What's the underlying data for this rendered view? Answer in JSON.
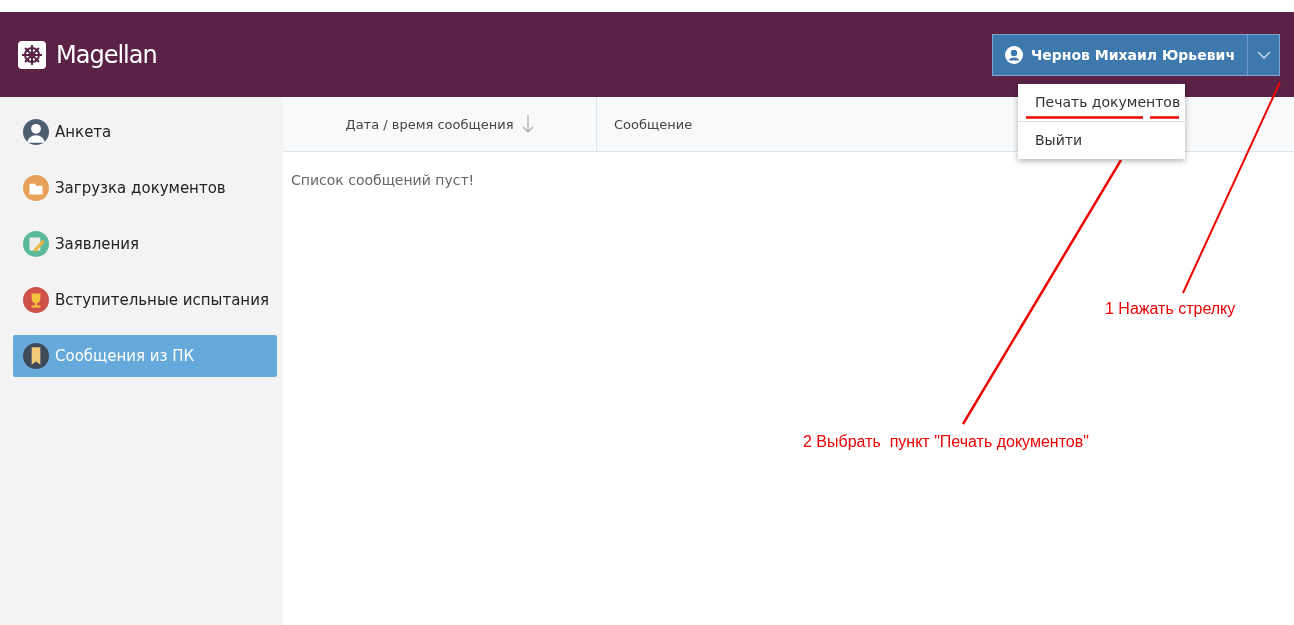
{
  "app": {
    "title": "Magellan"
  },
  "user": {
    "name": "Чернов Михаил Юрьевич",
    "menu_open": true
  },
  "user_menu": [
    {
      "label": "Печать документов"
    },
    {
      "label": "Выйти"
    }
  ],
  "sidebar": {
    "items": [
      {
        "label": "Анкета",
        "kind": "person",
        "color": "#4e5e72",
        "selected": false
      },
      {
        "label": "Загрузка документов",
        "kind": "folder",
        "color": "#e8a15a",
        "selected": false
      },
      {
        "label": "Заявления",
        "kind": "edit",
        "color": "#5cb99a",
        "selected": false
      },
      {
        "label": "Вступительные испытания",
        "kind": "trophy",
        "color": "#d0504a",
        "selected": false
      },
      {
        "label": "Сообщения из ПК",
        "kind": "bookmark",
        "color": "#3f4b5b",
        "selected": true
      }
    ]
  },
  "table": {
    "columns": [
      {
        "label": "Дата / время сообщения",
        "sorted": true
      },
      {
        "label": "Сообщение",
        "sorted": false
      }
    ],
    "empty_text": "Список сообщений пуст!"
  },
  "annotations": [
    {
      "label": "1 Нажать стрелку"
    },
    {
      "label": "2 Выбрать  пункт \"Печать документов\""
    }
  ]
}
